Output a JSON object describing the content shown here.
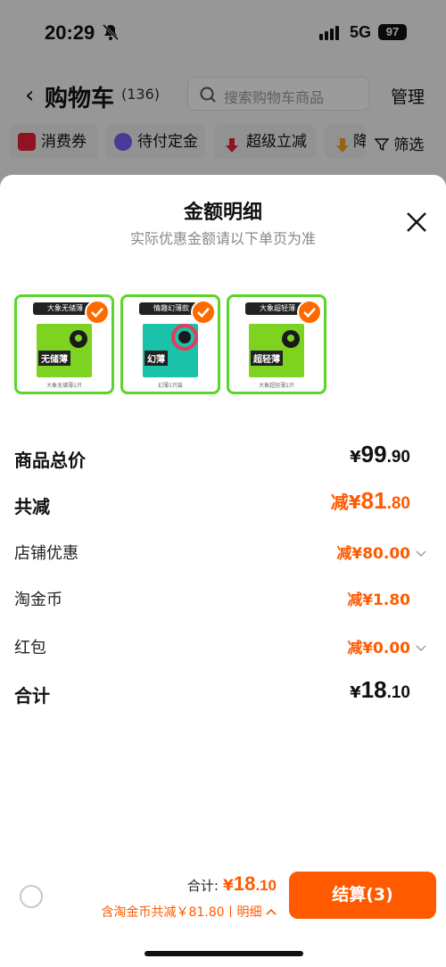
{
  "status": {
    "time": "20:29",
    "network": "5G",
    "battery": "97"
  },
  "nav": {
    "title": "购物车",
    "count": "(136)",
    "search_placeholder": "搜索购物车商品",
    "manage": "管理"
  },
  "chips": [
    {
      "label": "消费券",
      "color": "#e8203a"
    },
    {
      "label": "待付定金",
      "color": "#7a5cf5"
    },
    {
      "label": "超级立减",
      "color": "#e8203a"
    },
    {
      "label": "降",
      "color": "#f0a020"
    }
  ],
  "filter": "筛选",
  "sheet": {
    "title": "金额明细",
    "subtitle": "实际优惠金额请以下单页为准",
    "products": [
      {
        "banner": "大象无储薄",
        "name": "无储薄",
        "caption": "大象无储薄1只",
        "color": "#7ed321"
      },
      {
        "banner": "情趣幻薄款",
        "name": "幻薄",
        "caption": "幻薄1只装",
        "color": "#19c2a8"
      },
      {
        "banner": "大象超轻薄",
        "name": "超轻薄",
        "caption": "大象超轻薄1只",
        "color": "#7ed321"
      }
    ],
    "rows": {
      "subtotal": {
        "label": "商品总价",
        "currency": "¥",
        "int": "99",
        "dec": ".90"
      },
      "discount": {
        "label": "共减",
        "prefix": "减¥",
        "int": "81",
        "dec": ".80"
      },
      "store": {
        "label": "店铺优惠",
        "value": "减¥80.00"
      },
      "coins": {
        "label": "淘金币",
        "value": "减¥1.80"
      },
      "redpacket": {
        "label": "红包",
        "value": "减¥0.00"
      },
      "total": {
        "label": "合计",
        "currency": "¥",
        "int": "18",
        "dec": ".10"
      }
    }
  },
  "bottom": {
    "total_label": "合计:",
    "total_currency": "¥",
    "total_int": "18",
    "total_dec": ".10",
    "detail": "含淘金币共减￥81.80丨明细",
    "checkout": "结算(3)"
  },
  "colors": {
    "accent": "#ff5a00",
    "green": "#5ad52a"
  }
}
